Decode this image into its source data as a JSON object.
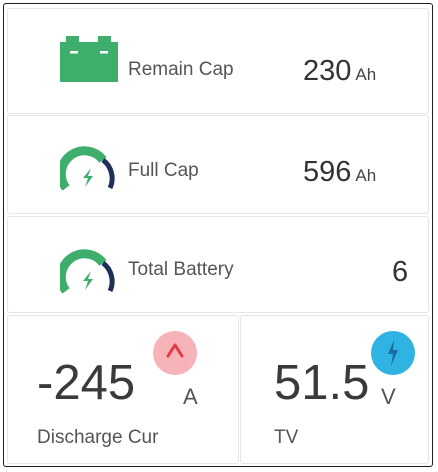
{
  "remain_cap": {
    "label": "Remain Cap",
    "value": "230",
    "unit": "Ah",
    "icon": "battery-icon"
  },
  "full_cap": {
    "label": "Full Cap",
    "value": "596",
    "unit": "Ah",
    "icon": "gauge-icon"
  },
  "total_battery": {
    "label": "Total Battery",
    "value": "6",
    "icon": "gauge-icon"
  },
  "discharge_cur": {
    "label": "Discharge Cur",
    "value": "-245",
    "unit": "A",
    "icon": "arrow-up-icon"
  },
  "tv": {
    "label": "TV",
    "value": "51.5",
    "unit": "V",
    "icon": "lightning-icon"
  },
  "colors": {
    "green": "#3fae6c",
    "navy": "#1f2f5a",
    "badge_red": "#f7b4b8",
    "badge_red_glyph": "#e53a45",
    "badge_blue": "#2fb3e3"
  }
}
